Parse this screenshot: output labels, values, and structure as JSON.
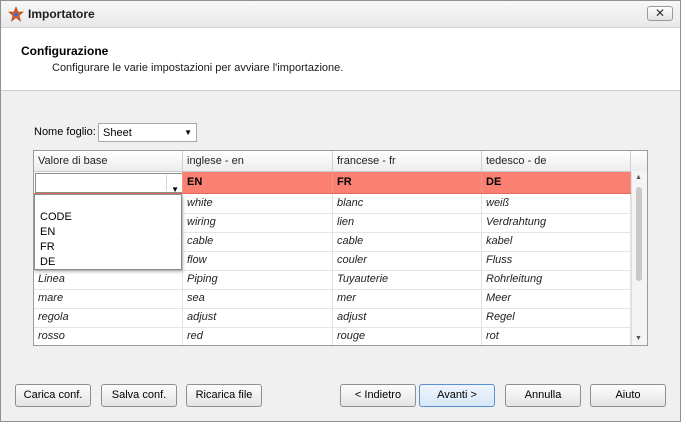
{
  "window": {
    "title": "Importatore"
  },
  "header": {
    "title": "Configurazione",
    "subtitle": "Configurare le varie impostazioni per avviare l'importazione."
  },
  "sheet": {
    "label": "Nome foglio:",
    "value": "Sheet"
  },
  "grid": {
    "columns": [
      "Valore di base",
      "inglese - en",
      "francese - fr",
      "tedesco - de"
    ],
    "lang_row": [
      "EN",
      "FR",
      "DE"
    ],
    "dropdown_options": [
      "CODE",
      "EN",
      "FR",
      "DE"
    ],
    "rows": [
      [
        "",
        "white",
        "blanc",
        "weiß"
      ],
      [
        "",
        "wiring",
        "lien",
        "Verdrahtung"
      ],
      [
        "",
        "cable",
        "cable",
        "kabel"
      ],
      [
        "",
        "flow",
        "couler",
        "Fluss"
      ],
      [
        "Linea",
        "Piping",
        "Tuyauterie",
        "Rohrleitung"
      ],
      [
        "mare",
        "sea",
        "mer",
        "Meer"
      ],
      [
        "regola",
        "adjust",
        "adjust",
        "Regel"
      ],
      [
        "rosso",
        "red",
        "rouge",
        "rot"
      ]
    ]
  },
  "buttons": {
    "load_conf": "Carica conf.",
    "save_conf": "Salva conf.",
    "reload_file": "Ricarica file",
    "back": "< Indietro",
    "next": "Avanti >",
    "cancel": "Annulla",
    "help": "Aiuto"
  },
  "colors": {
    "lang_row": "#fa8072",
    "primary_button": "#5a8fd0"
  }
}
